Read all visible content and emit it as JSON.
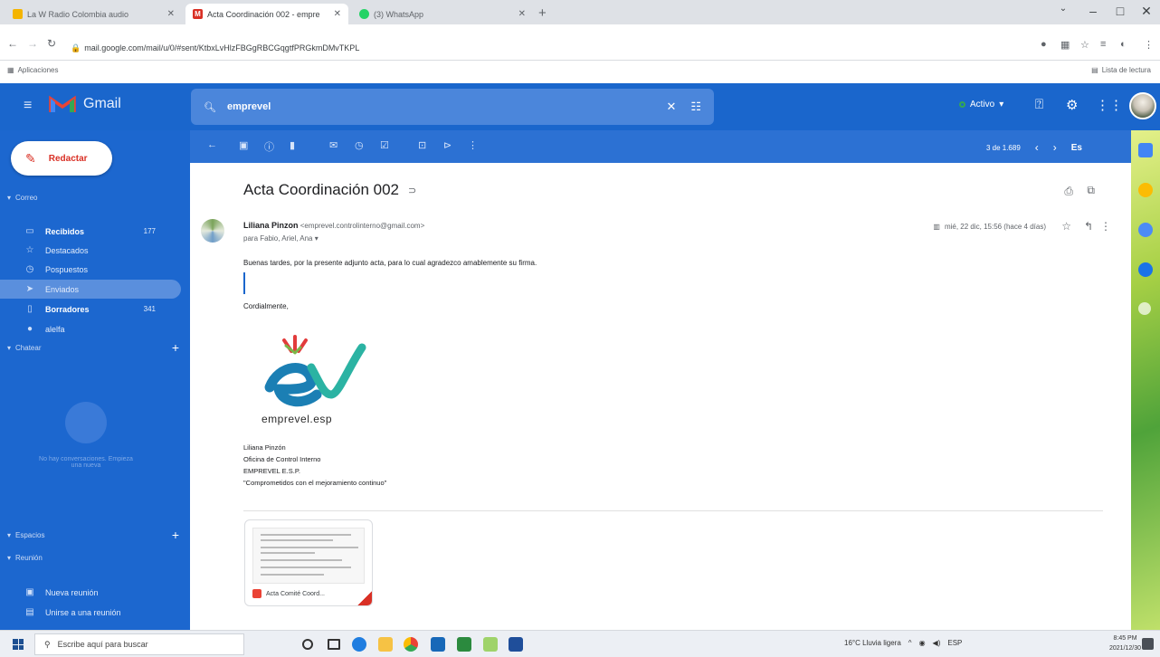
{
  "browser": {
    "tabs": [
      {
        "title": "La W Radio Colombia audio",
        "active": false,
        "favicon_color": "#f4b400"
      },
      {
        "title": "Acta Coordinación 002 - empre",
        "active": true,
        "favicon_color": "#d93025"
      },
      {
        "title": "(3) WhatsApp",
        "active": false,
        "favicon_color": "#25d366"
      }
    ],
    "new_tab_label": "+",
    "url": "mail.google.com/mail/u/0/#sent/KtbxLvHlzFBGgRBCGqgtfPRGkmDMvTKPL",
    "bookmarks_apps_label": "Aplicaciones",
    "reading_list_label": "Lista de lectura"
  },
  "gmail": {
    "brand": "Gmail",
    "search_query": "emprevel",
    "status_label": "Activo",
    "status_color": "#34a853",
    "compose_label": "Redactar",
    "sections": {
      "mail": "Correo",
      "chat": "Chatear",
      "spaces": "Espacios",
      "meet": "Reunión"
    },
    "folders": [
      {
        "label": "Recibidos",
        "count": "177",
        "icon": "inbox-icon",
        "bold": true,
        "selected": false
      },
      {
        "label": "Destacados",
        "count": "",
        "icon": "star-icon",
        "bold": false,
        "selected": false
      },
      {
        "label": "Pospuestos",
        "count": "",
        "icon": "clock-icon",
        "bold": false,
        "selected": false
      },
      {
        "label": "Enviados",
        "count": "",
        "icon": "send-icon",
        "bold": false,
        "selected": true
      },
      {
        "label": "Borradores",
        "count": "341",
        "icon": "draft-icon",
        "bold": true,
        "selected": false
      },
      {
        "label": "alelfa",
        "count": "",
        "icon": "label-icon",
        "bold": false,
        "selected": false
      }
    ],
    "chat_empty_text": "No hay conversaciones. Empieza una nueva",
    "meet_items": [
      {
        "label": "Nueva reunión",
        "icon": "video-icon"
      },
      {
        "label": "Unirse a una reunión",
        "icon": "keyboard-icon"
      }
    ],
    "pager": {
      "range": "3 de 1.689",
      "input_tools": "Es"
    }
  },
  "email": {
    "subject": "Acta Coordinación 002",
    "sender_name": "Liliana Pinzon",
    "sender_email": "<emprevel.controlinterno@gmail.com>",
    "recipients": "para Fabio, Ariel, Ana",
    "date": "mié, 22 dic, 15:56 (hace 4 días)",
    "body_greeting": "Buenas tardes, por la presente adjunto acta, para lo cual agradezco amablemente su firma.",
    "body_closing": "Cordialmente,",
    "logo_text": "emprevel.esp",
    "signature_lines": [
      "Liliana Pinzón",
      "Oficina de Control Interno",
      "EMPREVEL E.S.P.",
      "\"Comprometidos con el mejoramiento continuo\""
    ],
    "attachment_name": "Acta Comité Coord..."
  },
  "taskbar": {
    "search_placeholder": "Escribe aquí para buscar",
    "weather": "16°C Lluvia ligera",
    "language": "ESP",
    "time": "8:45 PM",
    "date": "2021/12/30"
  }
}
